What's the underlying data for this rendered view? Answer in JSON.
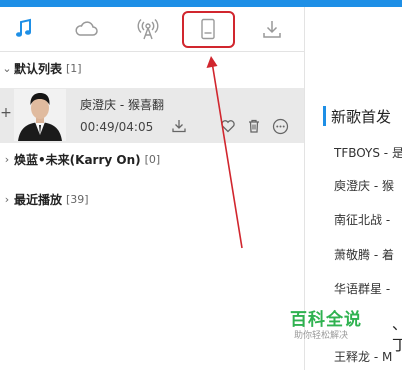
{
  "tabs": [
    {
      "name": "tab-music",
      "icon": "music-note-icon",
      "active": true
    },
    {
      "name": "tab-cloud",
      "icon": "cloud-icon"
    },
    {
      "name": "tab-radio",
      "icon": "radio-broadcast-icon"
    },
    {
      "name": "tab-device",
      "icon": "phone-device-icon"
    },
    {
      "name": "tab-download",
      "icon": "download-icon"
    }
  ],
  "playlists": {
    "default": {
      "label": "默认列表",
      "count": "[1]"
    },
    "karry": {
      "label": "焕蓝•未来(Karry On)",
      "count": "[0]"
    },
    "recent": {
      "label": "最近播放",
      "count": "[39]"
    }
  },
  "song": {
    "title": "庾澄庆 - 猴喜翻",
    "time": "00:49/04:05"
  },
  "news": {
    "title": "新歌首发",
    "items": [
      "TFBOYS - 是",
      "庾澄庆 - 猴",
      "南征北战 -",
      "萧敬腾 - 着",
      "华语群星 -",
      "、丁",
      "王释龙 - M"
    ]
  },
  "watermark": {
    "title": "百科全说",
    "subtitle": "助你轻松解决"
  },
  "colors": {
    "accent": "#1e8fe6",
    "annotation": "#d1262e",
    "watermark": "#2fb250"
  }
}
